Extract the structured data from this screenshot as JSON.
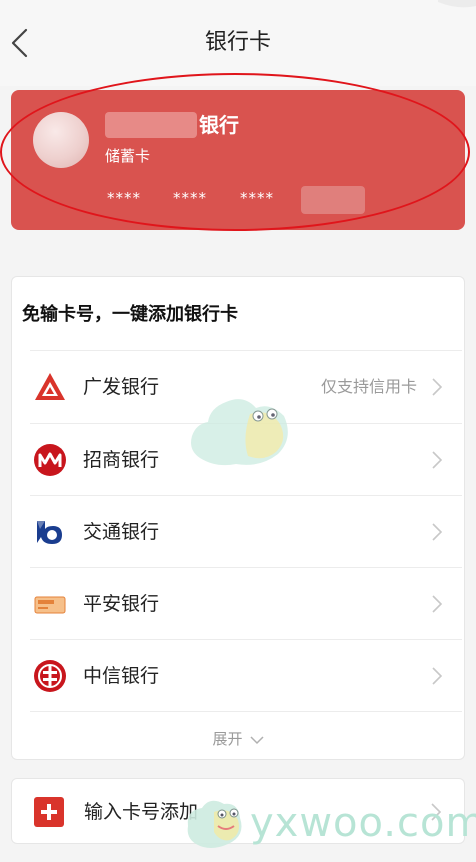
{
  "header": {
    "title": "银行卡"
  },
  "card": {
    "bank_name": "银行",
    "card_type": "储蓄卡",
    "mask_groups": [
      "****",
      "****",
      "****"
    ]
  },
  "quick_add": {
    "title": "免输卡号，一键添加银行卡",
    "banks": [
      {
        "name": "广发银行",
        "note": "仅支持信用卡",
        "icon": "cgb-logo-icon"
      },
      {
        "name": "招商银行",
        "note": "",
        "icon": "cmb-logo-icon"
      },
      {
        "name": "交通银行",
        "note": "",
        "icon": "bocom-logo-icon"
      },
      {
        "name": "平安银行",
        "note": "",
        "icon": "pingan-card-icon"
      },
      {
        "name": "中信银行",
        "note": "",
        "icon": "citic-logo-icon"
      }
    ],
    "expand_label": "展开"
  },
  "manual_add": {
    "label": "输入卡号添加"
  },
  "watermark": {
    "text": "yxwoo.com"
  },
  "colors": {
    "card_bg": "#d9534f",
    "circle_annotation": "#e0151b",
    "accent_red": "#d9342b"
  }
}
